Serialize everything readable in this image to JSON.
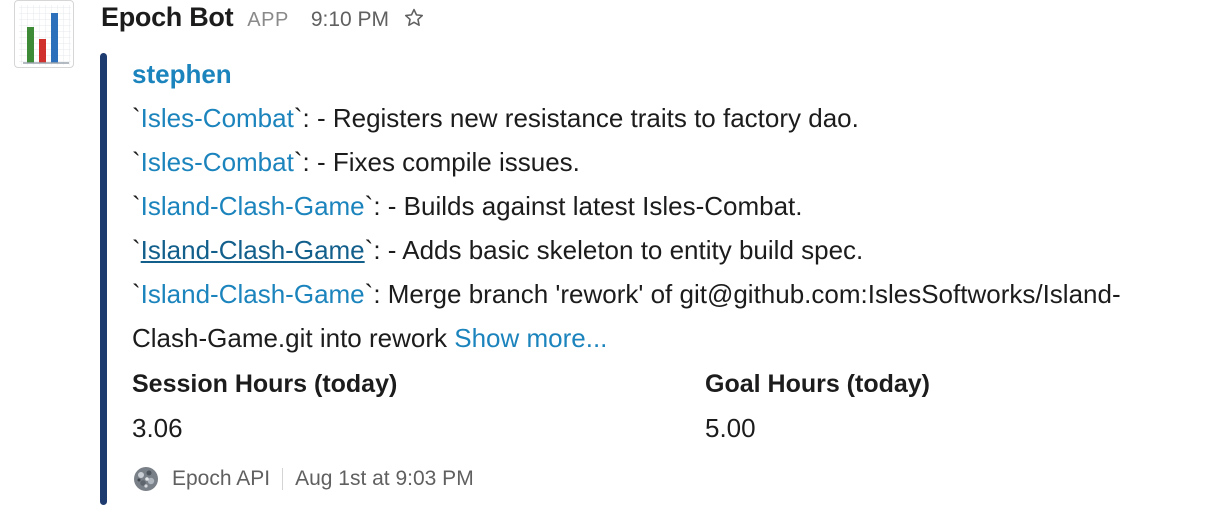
{
  "message": {
    "bot_name": "Epoch Bot",
    "app_badge": "APP",
    "time": "9:10 PM",
    "avatar_icon": "bar-chart-icon",
    "star_icon": "star-outline-icon"
  },
  "attachment": {
    "accent_color": "#1d3b6e",
    "author": "stephen",
    "commits": [
      {
        "tick_open": "`",
        "repo": "Isles-Combat",
        "tick_close": "`",
        "message": ": - Registers new resistance traits to factory dao."
      },
      {
        "tick_open": "`",
        "repo": "Isles-Combat",
        "tick_close": "`",
        "message": ": - Fixes compile issues."
      },
      {
        "tick_open": "`",
        "repo": "Island-Clash-Game",
        "tick_close": "`",
        "message": ": - Builds against latest Isles-Combat."
      },
      {
        "tick_open": "`",
        "repo": "Island-Clash-Game",
        "tick_close": "`",
        "message": ": - Adds basic skeleton to entity build spec."
      },
      {
        "tick_open": "`",
        "repo": "Island-Clash-Game",
        "tick_close": "`",
        "message": ": Merge branch 'rework' of git@github.com:IslesSoftworks/Island-",
        "continuation": "Clash-Game.git into rework "
      }
    ],
    "show_more": "Show more...",
    "fields": [
      {
        "title": "Session Hours (today)",
        "value": "3.06"
      },
      {
        "title": "Goal Hours (today)",
        "value": "5.00"
      }
    ],
    "footer": {
      "icon": "epoch-api-icon",
      "source": "Epoch API",
      "timestamp": "Aug 1st at 9:03 PM"
    }
  }
}
